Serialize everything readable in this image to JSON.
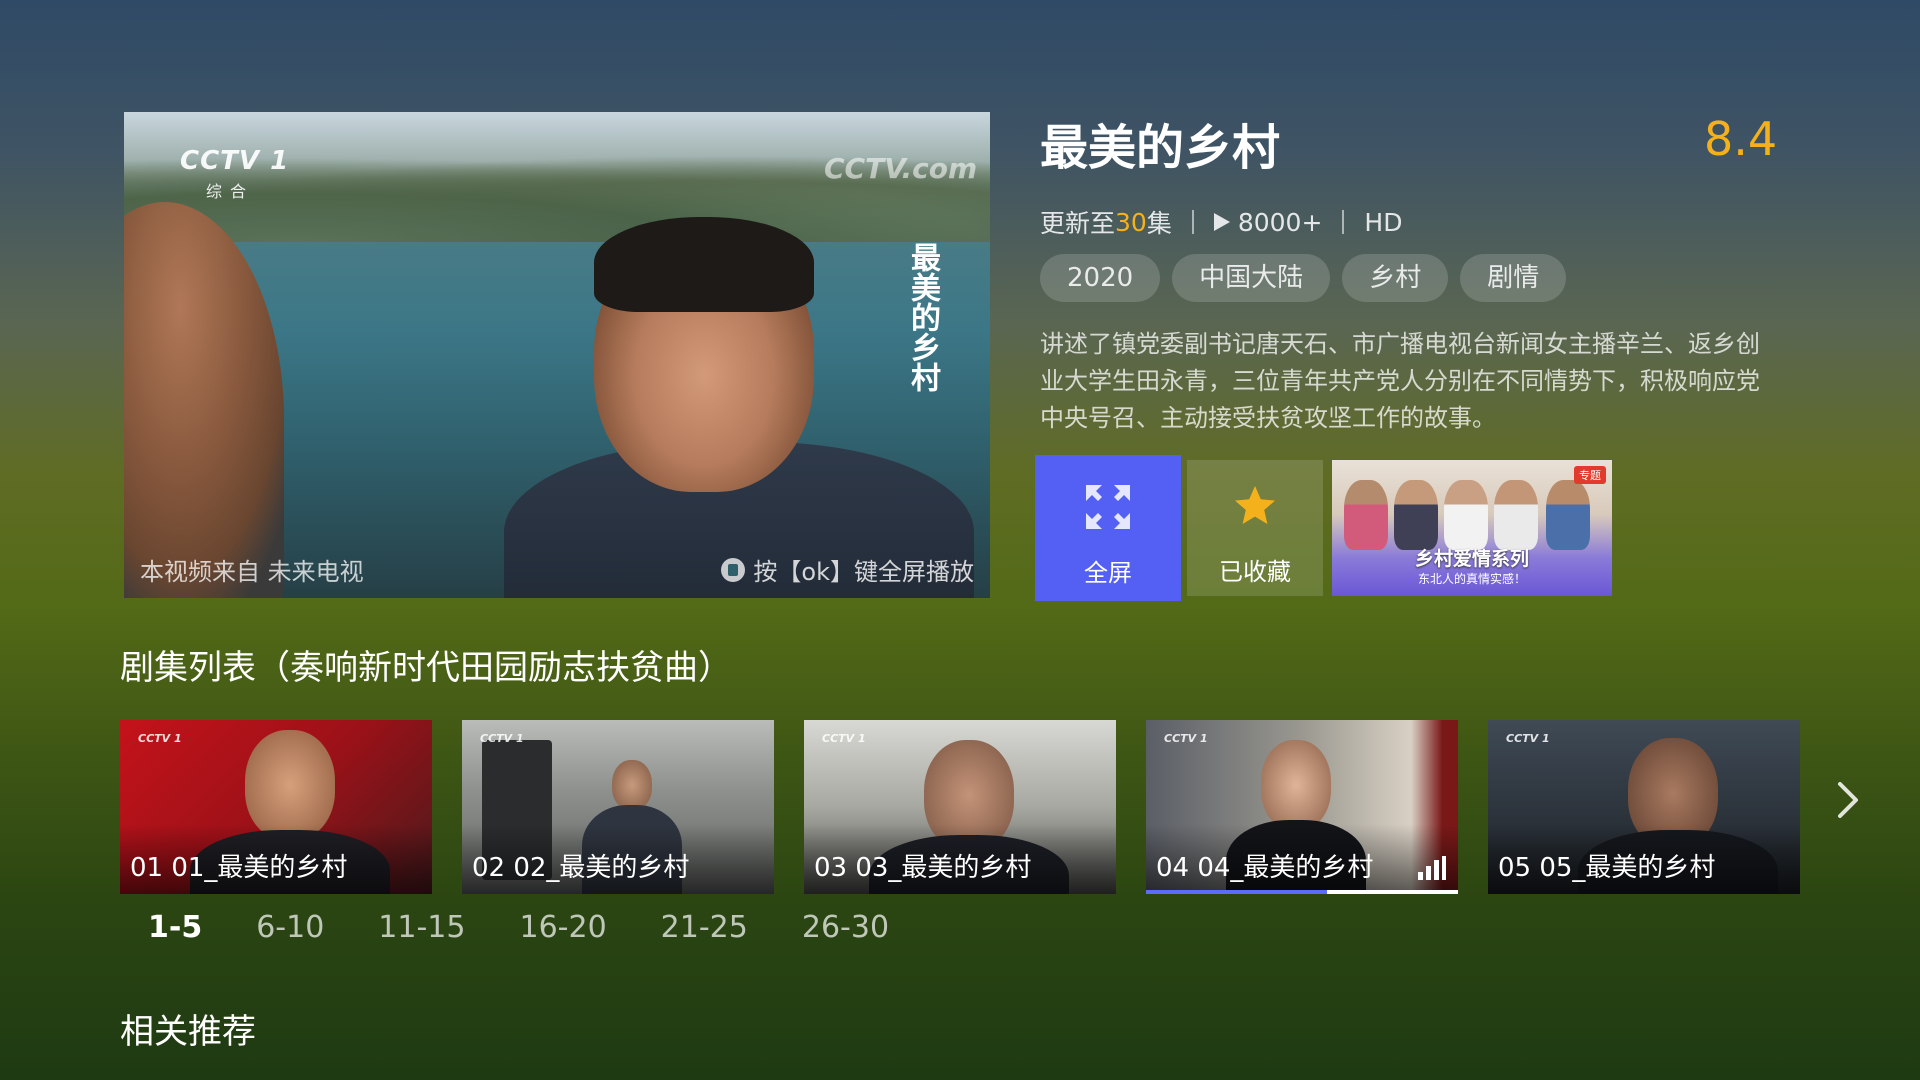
{
  "player": {
    "channel_logo": "CCTV 1",
    "channel_sub": "综合",
    "watermark": "CCTV.com",
    "overlay_title": "最美的乡村",
    "source_text": "本视频来自 未来电视",
    "ok_hint": "按【ok】键全屏播放"
  },
  "info": {
    "title": "最美的乡村",
    "rating": "8.4",
    "update_prefix": "更新至",
    "update_count": "30",
    "update_suffix": "集",
    "play_count": "8000+",
    "quality": "HD",
    "tags": [
      "2020",
      "中国大陆",
      "乡村",
      "剧情"
    ],
    "description": "讲述了镇党委副书记唐天石、市广播电视台新闻女主播辛兰、返乡创业大学生田永青，三位青年共产党人分别在不同情势下，积极响应党中央号召、主动接受扶贫攻坚工作的故事。"
  },
  "actions": {
    "fullscreen_label": "全屏",
    "favorite_label": "已收藏"
  },
  "promo": {
    "title": "乡村爱情系列",
    "subtitle": "东北人的真情实感！",
    "badge": "专题"
  },
  "episodes_section": {
    "title": "剧集列表（奏响新时代田园励志扶贫曲）",
    "episodes": [
      {
        "label": "01 01_最美的乡村"
      },
      {
        "label": "02 02_最美的乡村"
      },
      {
        "label": "03 03_最美的乡村"
      },
      {
        "label": "04 04_最美的乡村",
        "playing": true,
        "progress": 0.58
      },
      {
        "label": "05 05_最美的乡村"
      }
    ],
    "ranges": [
      "1-5",
      "6-10",
      "11-15",
      "16-20",
      "21-25",
      "26-30"
    ],
    "active_range": "1-5"
  },
  "related_section": {
    "title": "相关推荐"
  },
  "colors": {
    "accent": "#f5b11c",
    "primary_button": "#5460f4",
    "progress": "#5b6cf5"
  },
  "icons": {
    "fullscreen": "expand-arrows-icon",
    "favorite": "star-icon",
    "play": "play-triangle-icon",
    "next": "chevron-right-icon",
    "playing": "equalizer-bars-icon"
  }
}
